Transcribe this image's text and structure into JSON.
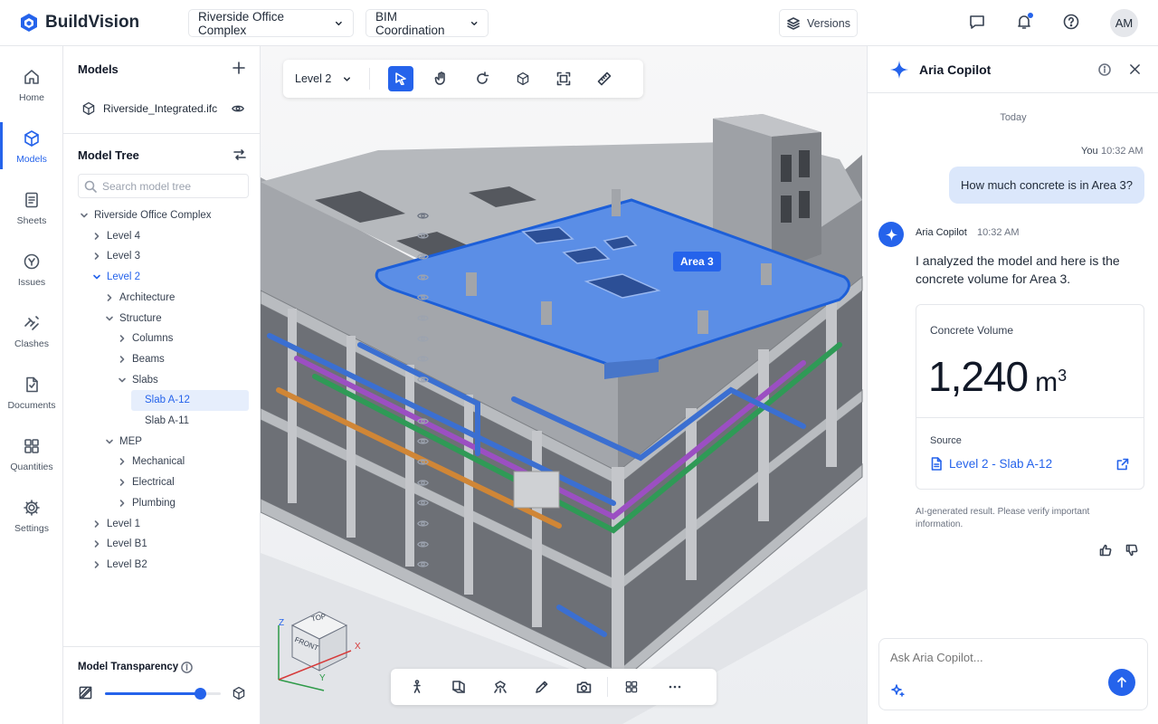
{
  "app": {
    "name": "BuildVision"
  },
  "header": {
    "project": "Riverside Office Complex",
    "workspace": "BIM Coordination",
    "versions_label": "Versions",
    "avatar_initials": "AM"
  },
  "rail": [
    {
      "label": "Home",
      "icon": "home-icon"
    },
    {
      "label": "Models",
      "icon": "cube-icon",
      "active": true
    },
    {
      "label": "Sheets",
      "icon": "sheet-icon"
    },
    {
      "label": "Issues",
      "icon": "issue-icon"
    },
    {
      "label": "Clashes",
      "icon": "clash-icon"
    },
    {
      "label": "Documents",
      "icon": "document-icon"
    },
    {
      "label": "Quantities",
      "icon": "grid-icon"
    },
    {
      "label": "Settings",
      "icon": "gear-icon"
    }
  ],
  "models": {
    "title": "Models",
    "file": "Riverside_Integrated.ifc"
  },
  "tree": {
    "title": "Model Tree",
    "search_placeholder": "Search model tree",
    "items": [
      {
        "label": "Riverside Office Complex",
        "expanded": true
      },
      {
        "label": "Level 4",
        "expanded": false
      },
      {
        "label": "Level 3",
        "expanded": false
      },
      {
        "label": "Level 2",
        "expanded": true
      },
      {
        "label": "Architecture",
        "expanded": false
      },
      {
        "label": "Structure",
        "expanded": true
      },
      {
        "label": "Columns",
        "expanded": false
      },
      {
        "label": "Beams",
        "expanded": false
      },
      {
        "label": "Slabs",
        "expanded": true
      },
      {
        "label": "Slab A-12",
        "selected": true
      },
      {
        "label": "Slab A-11"
      },
      {
        "label": "MEP",
        "expanded": true
      },
      {
        "label": "Mechanical",
        "expanded": false
      },
      {
        "label": "Electrical",
        "expanded": false
      },
      {
        "label": "Plumbing",
        "expanded": false
      },
      {
        "label": "Level 1",
        "expanded": false
      },
      {
        "label": "Level B1",
        "expanded": false
      },
      {
        "label": "Level B2",
        "expanded": false
      }
    ]
  },
  "transparency": {
    "label": "Model Transparency",
    "value": 0.82
  },
  "viewport": {
    "level": "Level 2",
    "area_label": "Area 3",
    "active_tool": "select",
    "viewcube": {
      "top": "TOP",
      "front": "FRONT",
      "x": "X",
      "y": "Y",
      "z": "Z"
    }
  },
  "copilot": {
    "title": "Aria Copilot",
    "day": "Today",
    "user_name": "You",
    "user_time": "10:32 AM",
    "user_message": "How much concrete is in Area 3?",
    "bot_name": "Aria Copilot",
    "bot_time": "10:32 AM",
    "bot_message": "I analyzed the model and here is the concrete volume for Area 3.",
    "card": {
      "title": "Concrete Volume",
      "value": "1,240",
      "unit": "m",
      "unit_exp": "3",
      "source_label": "Source",
      "source_link": "Level 2 - Slab A-12"
    },
    "disclaimer": "AI-generated result. Please verify important information.",
    "input_placeholder": "Ask Aria Copilot..."
  },
  "colors": {
    "accent": "#2563eb",
    "selection": "#e6eefc",
    "bubble": "#dbe7fb"
  }
}
